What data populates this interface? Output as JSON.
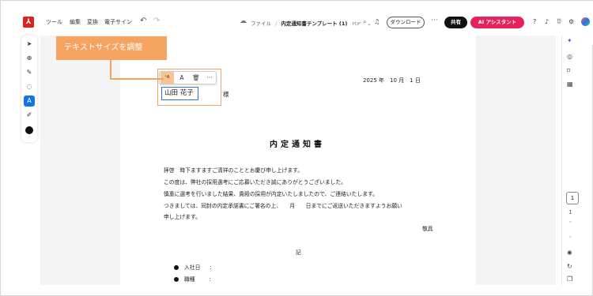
{
  "topbar": {
    "logo_icon": "acrobat-logo-icon",
    "menus": [
      "ツール",
      "編集",
      "変換",
      "電子サイン"
    ],
    "breadcrumb": {
      "folder": "ファイル",
      "separator": "/",
      "document": "内定通知書テンプレート (1)",
      "ext": "PDF"
    },
    "download_label": "ダウンロード",
    "share_label": "共有",
    "ai_label": "AI アシスタント",
    "colors": {
      "ai_button": "#e6225c",
      "share_button": "#111111"
    }
  },
  "callout": {
    "label": "テキストサイズを調整",
    "color": "#f4a460"
  },
  "mini_toolbar": {
    "size_small": "ᴬA",
    "size_large": "A",
    "delete_icon": "🗑",
    "more": "···"
  },
  "text_field": {
    "value": "山田 花子"
  },
  "document": {
    "date": "2025 年　10 月　1 日",
    "honorific": "様",
    "title": "内定通知書",
    "lines": [
      "拝啓　時下ますますご清祥のこととお慶び申し上げます。",
      "この度は、弊社の採用選考にご応募いただき誠にありがとうございました。",
      "慎重に選考を行いました結果、貴殿の採用が内定いたしましたので、ご連絡いたします。",
      "つきましては、同封の内定承諾書にご署名の上、　　月　　日までにご返送いただきますようお願い",
      "申し上げます。"
    ],
    "closing": "敬具",
    "ki": "記",
    "items": [
      {
        "label": "入社日",
        "value": ""
      },
      {
        "label": "職種",
        "value": ""
      }
    ],
    "colon": ":"
  },
  "pager": {
    "current": "1",
    "total": "1"
  }
}
